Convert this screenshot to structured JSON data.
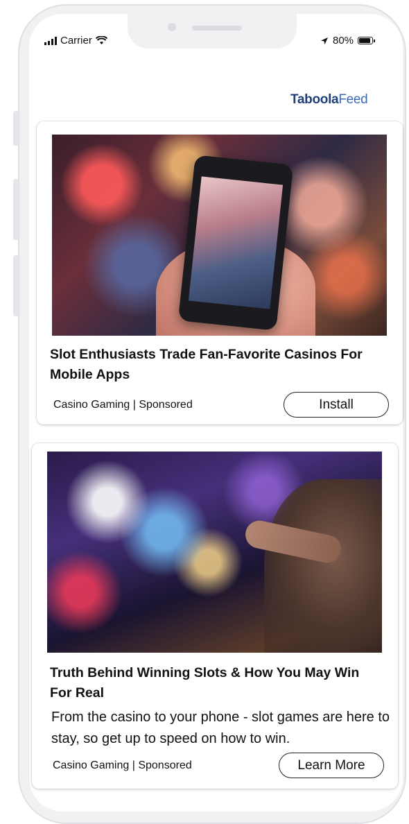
{
  "status_bar": {
    "carrier": "Carrier",
    "battery": "80%"
  },
  "brand": {
    "name_bold": "Taboola",
    "name_light": "Feed"
  },
  "feed": {
    "items": [
      {
        "title": "Slot Enthusiasts Trade Fan-Favorite Casinos For Mobile Apps",
        "meta": "Casino Gaming | Sponsored",
        "cta": "Install"
      },
      {
        "title": "Truth Behind Winning Slots & How You May Win For Real",
        "description": "From the casino to your phone - slot games are here to stay, so get up to speed on how to win.",
        "meta": "Casino Gaming | Sponsored",
        "cta": "Learn More"
      }
    ]
  },
  "colors": {
    "brand_dark": "#1f3f79",
    "brand_light": "#3c69b5",
    "phone_frame": "#f1f1f3"
  }
}
